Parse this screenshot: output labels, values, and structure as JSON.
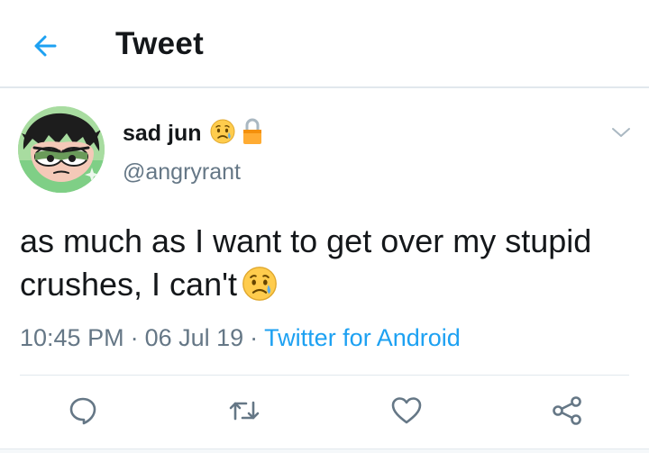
{
  "header": {
    "title": "Tweet",
    "back_icon": "arrow-left-icon",
    "accent_color": "#1da1f2"
  },
  "tweet": {
    "display_name": "sad jun",
    "name_emoji": "sad-but-relieved-face-emoji",
    "protected_icon": "lock-icon",
    "username": "@angryrant",
    "text": "as much as I want to get over my stupid crushes, I can't",
    "text_emoji": "sad-but-relieved-face-emoji",
    "time": "10:45 PM",
    "date": "06 Jul 19",
    "separator": "·",
    "source": "Twitter for Android"
  },
  "actions": [
    {
      "name": "reply",
      "icon": "reply-icon"
    },
    {
      "name": "retweet",
      "icon": "retweet-icon"
    },
    {
      "name": "like",
      "icon": "heart-icon"
    },
    {
      "name": "share",
      "icon": "share-icon"
    }
  ],
  "colors": {
    "text_primary": "#14171a",
    "text_secondary": "#657786",
    "link": "#1da1f2",
    "divider": "#e1e8ed"
  }
}
